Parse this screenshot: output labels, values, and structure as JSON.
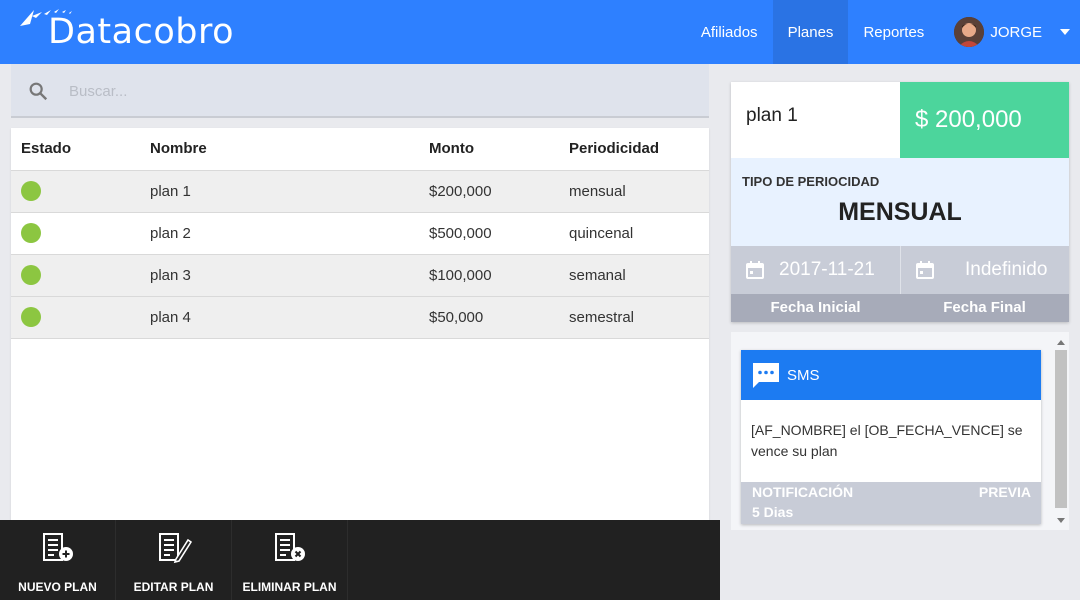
{
  "app": {
    "logo_text": "Datacobro",
    "brand_color": "#2e80ff"
  },
  "nav": {
    "items": [
      "Afiliados",
      "Planes",
      "Reportes"
    ],
    "active": "Planes",
    "user_name": "JORGE"
  },
  "search": {
    "placeholder": "Buscar..."
  },
  "table": {
    "headers": [
      "Estado",
      "Nombre",
      "Monto",
      "Periodicidad"
    ],
    "rows": [
      {
        "estado": "active",
        "nombre": "plan 1",
        "monto": "$200,000",
        "periodicidad": "mensual"
      },
      {
        "estado": "active",
        "nombre": "plan 2",
        "monto": "$500,000",
        "periodicidad": "quincenal"
      },
      {
        "estado": "active",
        "nombre": "plan 3",
        "monto": "$100,000",
        "periodicidad": "semanal"
      },
      {
        "estado": "active",
        "nombre": "plan 4",
        "monto": "$50,000",
        "periodicidad": "semestral"
      }
    ],
    "status_color": "#8cc641"
  },
  "toolbar": {
    "new_label": "NUEVO PLAN",
    "edit_label": "EDITAR PLAN",
    "delete_label": "ELIMINAR PLAN"
  },
  "plan_detail": {
    "name": "plan 1",
    "amount": "$ 200,000",
    "period_type_label": "TIPO DE PERIOCIDAD",
    "period_value": "MENSUAL",
    "start_date": "2017-11-21",
    "end_date": "Indefinido",
    "start_label": "Fecha Inicial",
    "end_label": "Fecha Final",
    "amount_color": "#4cd59c"
  },
  "notification": {
    "channel": "SMS",
    "message": "[AF_NOMBRE] el [OB_FECHA_VENCE] se vence su plan",
    "notif_label": "NOTIFICACIÓN",
    "preview_label": "PREVIA",
    "days": "5 Dias"
  }
}
